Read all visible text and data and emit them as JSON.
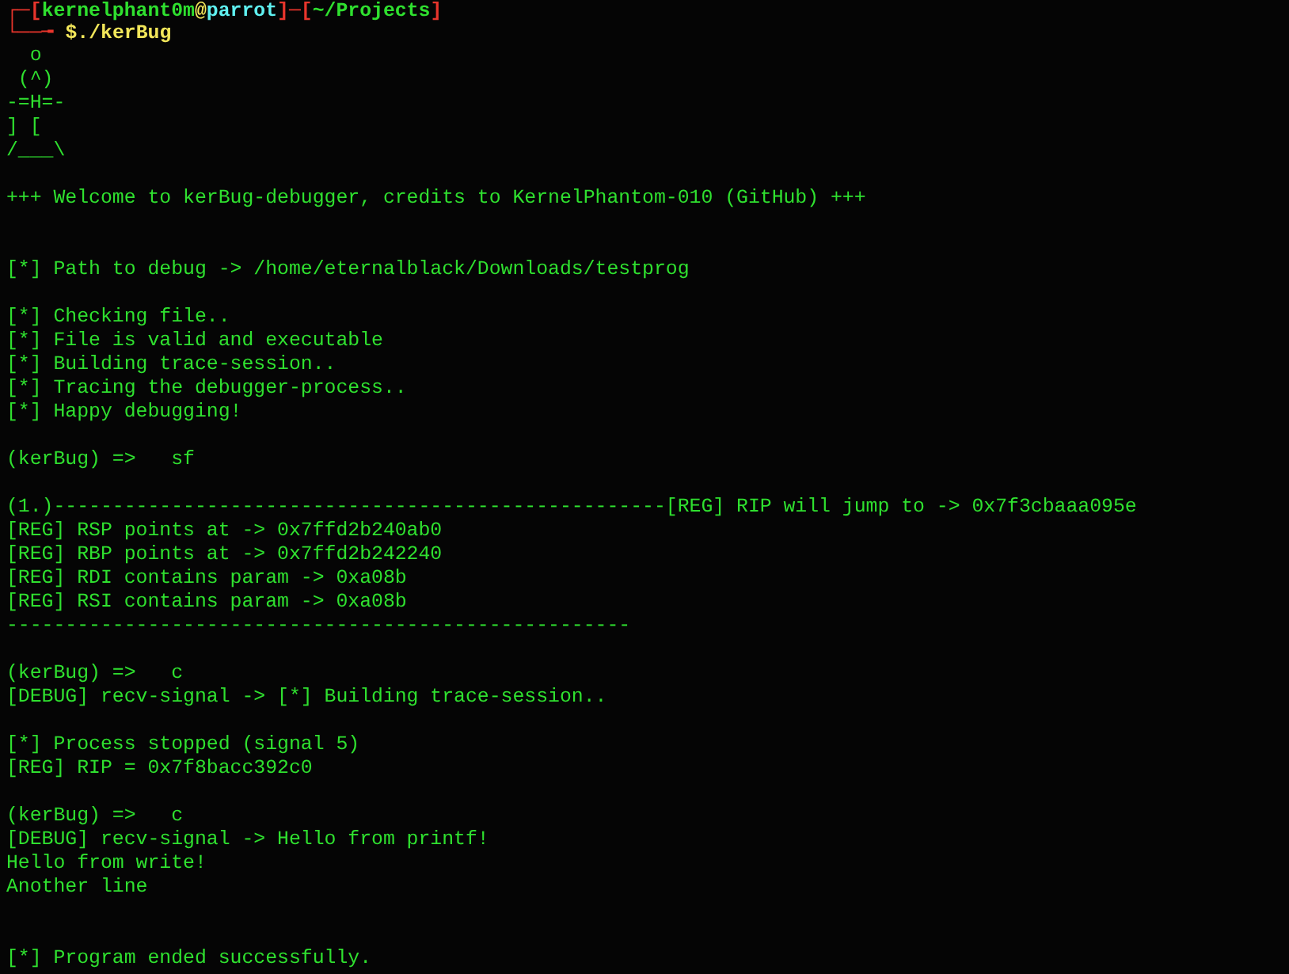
{
  "terminal": {
    "lines": [
      {
        "kind": "prompt",
        "segments": [
          {
            "text": "┌─[",
            "color": "#e8352c"
          },
          {
            "text": "kernelphant0m",
            "color": "#2fe02f"
          },
          {
            "text": "@",
            "color": "#f2e65a"
          },
          {
            "text": "parrot",
            "color": "#5ff0f0"
          },
          {
            "text": "]─[",
            "color": "#e8352c"
          },
          {
            "text": "~/Projects",
            "color": "#2fe02f"
          },
          {
            "text": "]",
            "color": "#e8352c"
          }
        ]
      },
      {
        "kind": "prompt",
        "segments": [
          {
            "text": "└──╼ ",
            "color": "#e8352c"
          },
          {
            "text": "$",
            "color": "#f2e65a"
          },
          {
            "text": "./kerBug",
            "color": "#f2e65a"
          }
        ]
      },
      {
        "kind": "art",
        "text": "  o"
      },
      {
        "kind": "art",
        "text": " (^)"
      },
      {
        "kind": "art",
        "text": "-=H=-"
      },
      {
        "kind": "art",
        "text": "] ["
      },
      {
        "kind": "art",
        "text": "/___\\"
      },
      {
        "kind": "blank"
      },
      {
        "kind": "output",
        "text": "+++ Welcome to kerBug-debugger, credits to KernelPhantom-010 (GitHub) +++"
      },
      {
        "kind": "blank"
      },
      {
        "kind": "blank"
      },
      {
        "kind": "output",
        "text": "[*] Path to debug -> /home/eternalblack/Downloads/testprog"
      },
      {
        "kind": "blank"
      },
      {
        "kind": "output",
        "text": "[*] Checking file.."
      },
      {
        "kind": "output",
        "text": "[*] File is valid and executable"
      },
      {
        "kind": "output",
        "text": "[*] Building trace-session.."
      },
      {
        "kind": "output",
        "text": "[*] Tracing the debugger-process.."
      },
      {
        "kind": "output",
        "text": "[*] Happy debugging!"
      },
      {
        "kind": "blank"
      },
      {
        "kind": "command",
        "text": "(kerBug) =>   sf"
      },
      {
        "kind": "blank"
      },
      {
        "kind": "output",
        "text": "(1.)----------------------------------------------------[REG] RIP will jump to -> 0x7f3cbaaa095e"
      },
      {
        "kind": "output",
        "text": "[REG] RSP points at -> 0x7ffd2b240ab0"
      },
      {
        "kind": "output",
        "text": "[REG] RBP points at -> 0x7ffd2b242240"
      },
      {
        "kind": "output",
        "text": "[REG] RDI contains param -> 0xa08b"
      },
      {
        "kind": "output",
        "text": "[REG] RSI contains param -> 0xa08b"
      },
      {
        "kind": "output",
        "text": "-----------------------------------------------------"
      },
      {
        "kind": "blank"
      },
      {
        "kind": "command",
        "text": "(kerBug) =>   c"
      },
      {
        "kind": "output",
        "text": "[DEBUG] recv-signal -> [*] Building trace-session.."
      },
      {
        "kind": "blank"
      },
      {
        "kind": "output",
        "text": "[*] Process stopped (signal 5)"
      },
      {
        "kind": "output",
        "text": "[REG] RIP = 0x7f8bacc392c0"
      },
      {
        "kind": "blank"
      },
      {
        "kind": "command",
        "text": "(kerBug) =>   c"
      },
      {
        "kind": "output",
        "text": "[DEBUG] recv-signal -> Hello from printf!"
      },
      {
        "kind": "output",
        "text": "Hello from write!"
      },
      {
        "kind": "output",
        "text": "Another line"
      },
      {
        "kind": "blank"
      },
      {
        "kind": "blank"
      },
      {
        "kind": "output",
        "text": "[*] Program ended successfully."
      }
    ]
  }
}
